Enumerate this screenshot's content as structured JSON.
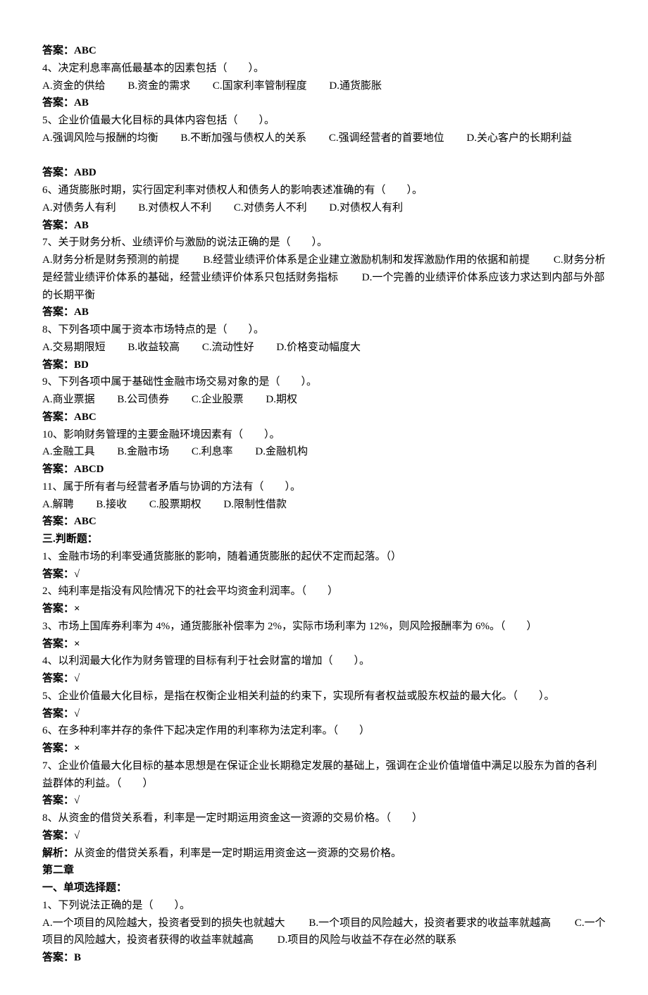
{
  "sec1": {
    "q3_ans": "答案：ABC",
    "q4": {
      "stem": "4、决定利息率高低最基本的因素包括（　　）。",
      "a": "A.资金的供给",
      "b": "B.资金的需求",
      "c": "C.国家利率管制程度",
      "d": "D.通货膨胀",
      "ans": "答案：AB"
    },
    "q5": {
      "stem": "5、企业价值最大化目标的具体内容包括（　　）。",
      "a": "A.强调风险与报酬的均衡",
      "b": "B.不断加强与债权人的关系",
      "c": "C.强调经营者的首要地位",
      "d": "D.关心客户的长期利益",
      "ans": "答案：ABD"
    },
    "q6": {
      "stem": "6、通货膨胀时期，实行固定利率对债权人和债务人的影响表述准确的有（　　）。",
      "a": "A.对债务人有利",
      "b": "B.对债权人不利",
      "c": "C.对债务人不利",
      "d": "D.对债权人有利",
      "ans": "答案：AB"
    },
    "q7": {
      "stem": "7、关于财务分析、业绩评价与激励的说法正确的是（　　）。",
      "a": "A.财务分析是财务预测的前提",
      "b": "B.经营业绩评价体系是企业建立激励机制和发挥激励作用的依据和前提",
      "c": "C.财务分析是经营业绩评价体系的基础，经营业绩评价体系只包括财务指标",
      "d": "D.一个完善的业绩评价体系应该力求达到内部与外部的长期平衡",
      "ans": "答案：AB"
    },
    "q8": {
      "stem": "8、下列各项中属于资本市场特点的是（　　）。",
      "a": "A.交易期限短",
      "b": "B.收益较高",
      "c": "C.流动性好",
      "d": "D.价格变动幅度大",
      "ans": "答案：BD"
    },
    "q9": {
      "stem": "9、下列各项中属于基础性金融市场交易对象的是（　　）。",
      "a": "A.商业票据",
      "b": "B.公司债券",
      "c": "C.企业股票",
      "d": "D.期权",
      "ans": "答案：ABC"
    },
    "q10": {
      "stem": "10、影响财务管理的主要金融环境因素有（　　）。",
      "a": "A.金融工具",
      "b": "B.金融市场",
      "c": "C.利息率",
      "d": "D.金融机构",
      "ans": "答案：ABCD"
    },
    "q11": {
      "stem": "11、属于所有者与经营者矛盾与协调的方法有（　　）。",
      "a": "A.解聘",
      "b": "B.接收",
      "c": "C.股票期权",
      "d": "D.限制性借款",
      "ans": "答案：ABC"
    }
  },
  "sec2": {
    "title": "三.判断题：",
    "q1": {
      "stem": "1、金融市场的利率受通货膨胀的影响，随着通货膨胀的起伏不定而起落。（）",
      "ans": "答案：√"
    },
    "q2": {
      "stem": "2、纯利率是指没有风险情况下的社会平均资金利润率。（　　）",
      "ans": "答案：×"
    },
    "q3": {
      "stem": "3、市场上国库券利率为 4%，通货膨胀补偿率为 2%，实际市场利率为 12%，则风险报酬率为 6%。（　　）",
      "ans": "答案：×"
    },
    "q4": {
      "stem": "4、以利润最大化作为财务管理的目标有利于社会财富的增加（　　）。",
      "ans": "答案：√"
    },
    "q5": {
      "stem": "5、企业价值最大化目标，是指在权衡企业相关利益的约束下，实现所有者权益或股东权益的最大化。（　　）。",
      "ans": "答案：√"
    },
    "q6": {
      "stem": "6、在多种利率并存的条件下起决定作用的利率称为法定利率。（　　）",
      "ans": "答案：×"
    },
    "q7": {
      "stem": "7、企业价值最大化目标的基本思想是在保证企业长期稳定发展的基础上，强调在企业价值增值中满足以股东为首的各利益群体的利益。（　　）",
      "ans": "答案：√"
    },
    "q8": {
      "stem": "8、从资金的借贷关系看，利率是一定时期运用资金这一资源的交易价格。（　　）",
      "ans": "答案：√",
      "expl_label": "解析：",
      "expl_text": "从资金的借贷关系看，利率是一定时期运用资金这一资源的交易价格。"
    }
  },
  "chap2": {
    "title": "第二章",
    "sec_title": "一、单项选择题：",
    "q1": {
      "stem": "1、下列说法正确的是（　　）。",
      "a": "A.一个项目的风险越大，投资者受到的损失也就越大",
      "b": "B.一个项目的风险越大，投资者要求的收益率就越高",
      "c": "C.一个项目的风险越大，投资者获得的收益率就越高",
      "d": "D.项目的风险与收益不存在必然的联系",
      "ans": "答案：B"
    }
  }
}
